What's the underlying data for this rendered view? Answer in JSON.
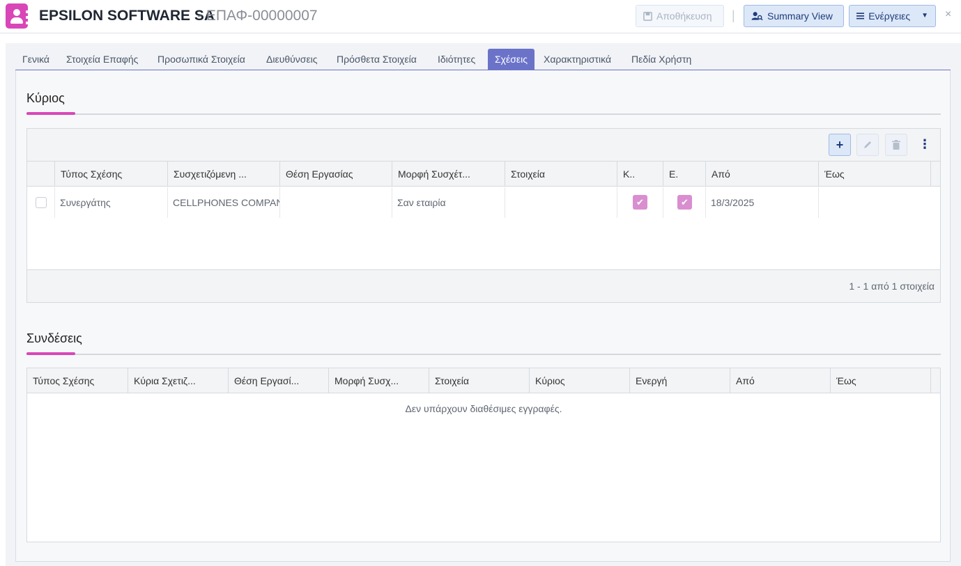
{
  "header": {
    "title": "EPSILON SOFTWARE SA",
    "separator": "-",
    "record_code": "ΕΠΑΦ-00000007",
    "save_label": "Αποθήκευση",
    "summary_label": "Summary View",
    "actions_label": "Ενέργειες",
    "close_symbol": "×"
  },
  "tabs": [
    {
      "label": "Γενικά"
    },
    {
      "label": "Στοιχεία Επαφής"
    },
    {
      "label": "Προσωπικά Στοιχεία"
    },
    {
      "label": "Διευθύνσεις"
    },
    {
      "label": "Πρόσθετα Στοιχεία"
    },
    {
      "label": "Ιδιότητες"
    },
    {
      "label": "Σχέσεις",
      "active": true
    },
    {
      "label": "Χαρακτηριστικά"
    },
    {
      "label": "Πεδία Χρήστη"
    }
  ],
  "primary": {
    "title": "Κύριος",
    "columns": [
      "Τύπος Σχέσης",
      "Συσχετιζόμενη ...",
      "Θέση Εργασίας",
      "Μορφή Συσχέτ...",
      "Στοιχεία",
      "Κ..",
      "Ε.",
      "Από",
      "Έως"
    ],
    "rows": [
      {
        "type": "Συνεργάτης",
        "related": "CELLPHONES COMPANY",
        "position": "",
        "form": "Σαν εταιρία",
        "details": "",
        "primary_checked": true,
        "active_checked": true,
        "from": "18/3/2025",
        "to": ""
      }
    ],
    "pager": "1 - 1 από 1 στοιχεία"
  },
  "links": {
    "title": "Συνδέσεις",
    "columns": [
      "Τύπος Σχέσης",
      "Κύρια Σχετιζ...",
      "Θέση Εργασί...",
      "Μορφή Συσχ...",
      "Στοιχεία",
      "Κύριος",
      "Ενεργή",
      "Από",
      "Έως"
    ],
    "empty": "Δεν υπάρχουν διαθέσιμες εγγραφές."
  },
  "colors": {
    "accent": "#6b73c9",
    "brand": "#d946b8",
    "check": "#d98ed0"
  },
  "icons": {
    "app": "contact-icon",
    "save": "floppy-disk-icon",
    "summary": "user-search-icon",
    "actions": "menu-lines-icon",
    "add": "plus-icon",
    "edit": "pencil-icon",
    "delete": "trash-icon",
    "more": "kebab-icon"
  }
}
